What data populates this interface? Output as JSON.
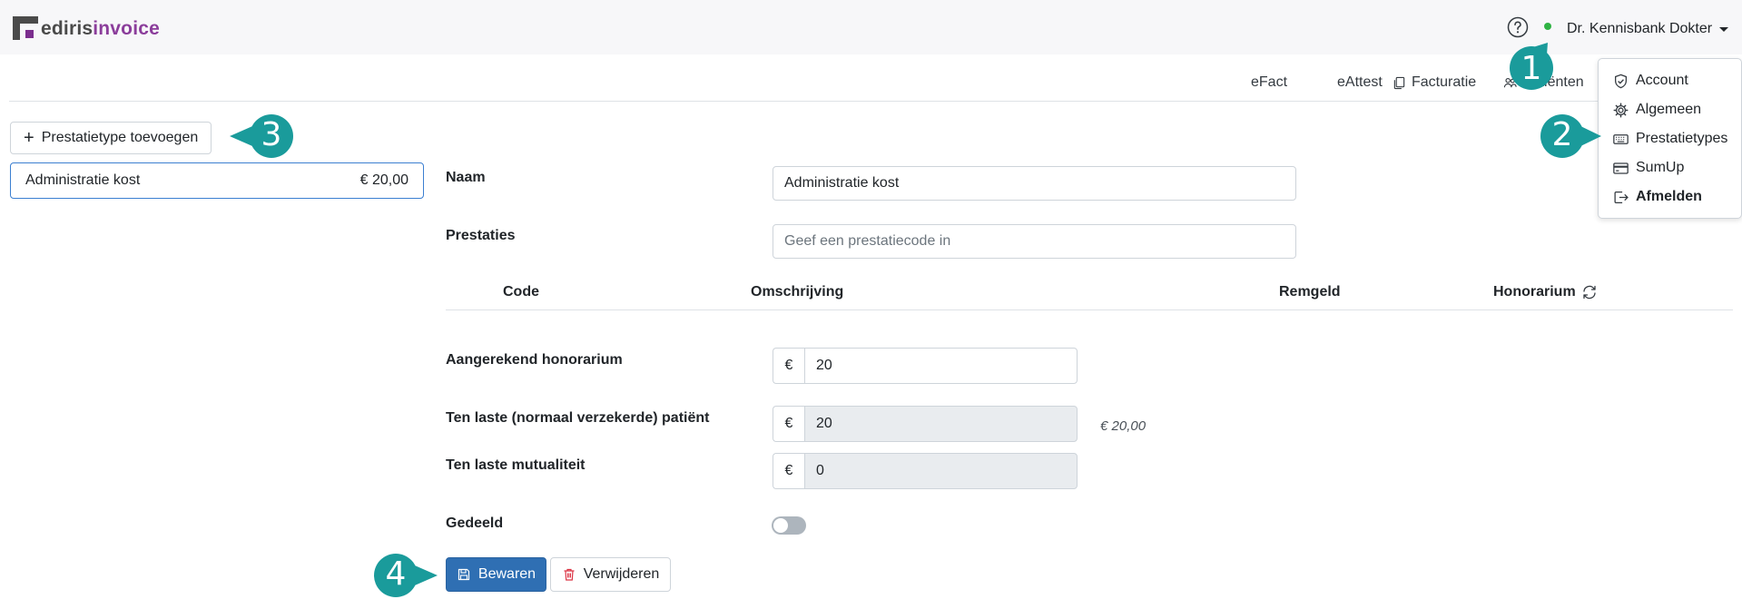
{
  "brand": {
    "logo_part1": "ediris",
    "logo_part2": "invoice"
  },
  "header": {
    "user_name": "Dr. Kennisbank Dokter"
  },
  "subnav": [
    {
      "label": "eFact"
    },
    {
      "label": "eAttest"
    },
    {
      "label": "Facturatie"
    },
    {
      "label": "Patiënten"
    }
  ],
  "user_menu": [
    {
      "label": "Account",
      "icon": "shield-check-icon"
    },
    {
      "label": "Algemeen",
      "icon": "gear-icon"
    },
    {
      "label": "Prestatietypes",
      "icon": "keyboard-icon"
    },
    {
      "label": "SumUp",
      "icon": "credit-card-icon"
    },
    {
      "label": "Afmelden",
      "icon": "logout-icon"
    }
  ],
  "left": {
    "add_button": "Prestatietype toevoegen",
    "items": [
      {
        "name": "Administratie kost",
        "price": "€ 20,00"
      }
    ]
  },
  "form": {
    "naam_label": "Naam",
    "naam_value": "Administratie kost",
    "prestaties_label": "Prestaties",
    "prestaties_placeholder": "Geef een prestatiecode in",
    "table_headers": {
      "code": "Code",
      "omschrijving": "Omschrijving",
      "remgeld": "Remgeld",
      "honorarium": "Honorarium"
    },
    "aangerekend_label": "Aangerekend honorarium",
    "aangerekend_value": "20",
    "patient_label": "Ten laste (normaal verzekerde) patiënt",
    "patient_value": "20",
    "patient_hint": "€ 20,00",
    "mutualiteit_label": "Ten laste mutualiteit",
    "mutualiteit_value": "0",
    "currency_symbol": "€",
    "gedeeld_label": "Gedeeld",
    "gedeeld_on": false
  },
  "actions": {
    "save": "Bewaren",
    "delete": "Verwijderen"
  },
  "callouts": [
    "1",
    "2",
    "3",
    "4"
  ],
  "colors": {
    "accent": "#2f6fb3",
    "callout": "#1a9b9b",
    "brand_purple": "#8b3d9b",
    "online": "#2fb344"
  }
}
